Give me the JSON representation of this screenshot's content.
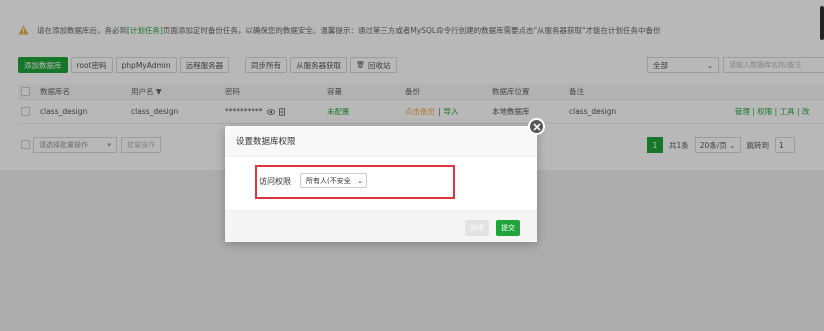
{
  "notice": {
    "before": "请在添加数据库后，务必到",
    "link": "[计划任务]",
    "after": "页面添加定时备份任务，以确保您的数据安全。温馨提示：通过第三方或者MySQL命令行创建的数据库需要点击\"从服务器获取\"才能在计划任务中备份"
  },
  "toolbar": {
    "add": "添加数据库",
    "root_pw": "root密码",
    "phpmyadmin": "phpMyAdmin",
    "remote": "远程服务器",
    "sync_all": "同步所有",
    "fetch": "从服务器获取",
    "recycle": "回收站"
  },
  "filter": {
    "selected": "全部",
    "search_placeholder": "请输入数据库名称/备注"
  },
  "table": {
    "headers": {
      "name": "数据库名",
      "user": "用户名 ▼",
      "password": "密码",
      "quota": "容量",
      "backup": "备份",
      "location": "数据库位置",
      "remark": "备注"
    },
    "row": {
      "name": "class_design",
      "user": "class_design",
      "password": "**********",
      "quota": "未配置",
      "backup_link": "点击备份",
      "import_link": "导入",
      "location": "本地数据库",
      "remark": "class_design",
      "ops": "管理 | 权限 | 工具 | 改"
    }
  },
  "bottom": {
    "batch_placeholder": "请选择批量操作",
    "batch_button": "批量操作",
    "current_page": "1",
    "total": "共1条",
    "page_size": "20条/页",
    "goto_label": "跳转到",
    "goto_value": "1"
  },
  "modal": {
    "title": "设置数据库权限",
    "perm_label": "访问权限",
    "perm_value": "所有人(不安全",
    "close_btn": "关闭",
    "submit_btn": "提交"
  },
  "colors": {
    "brand": "#20a53a",
    "warning": "#f0ad4e",
    "highlight": "#d9363e"
  }
}
